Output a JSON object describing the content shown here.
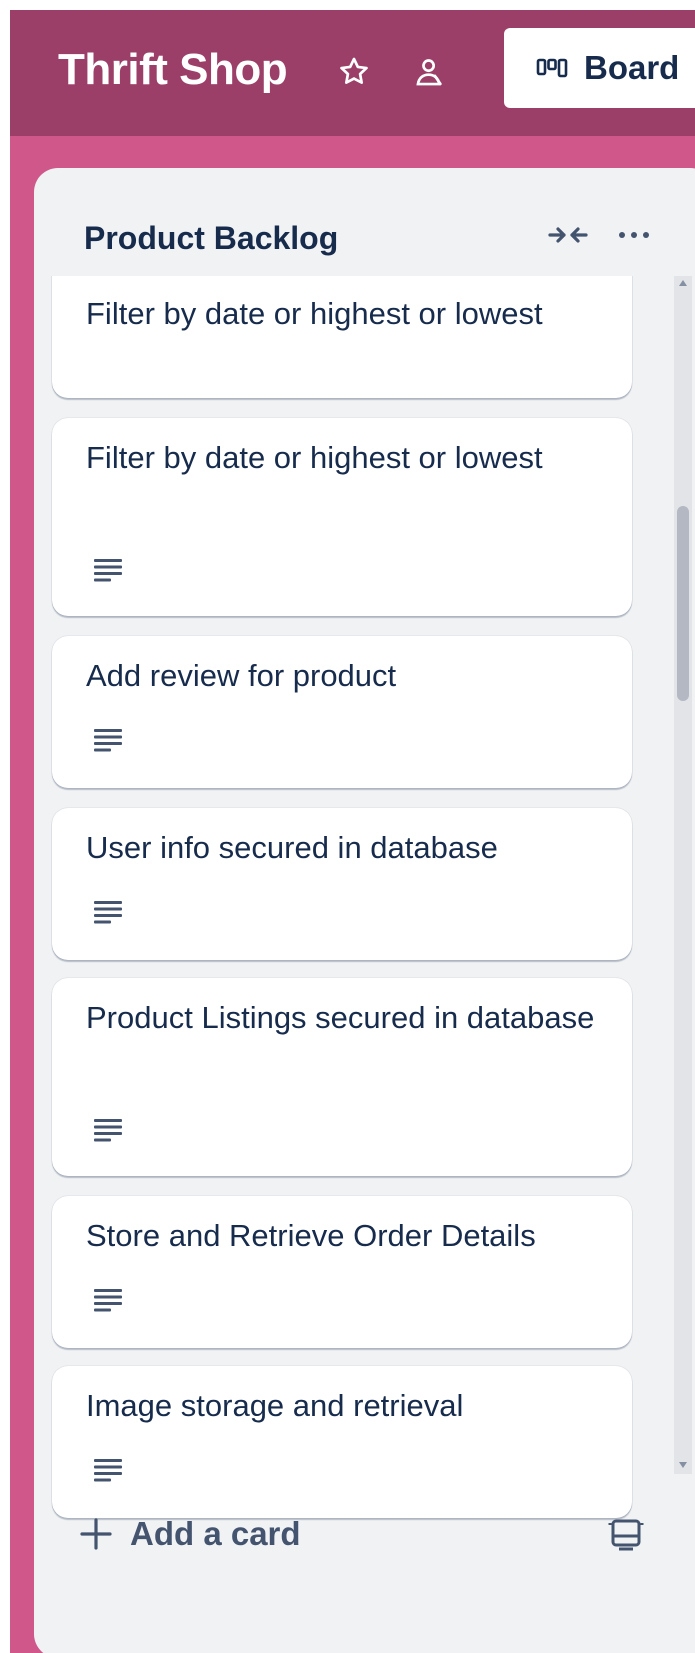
{
  "board": {
    "title": "Thrift Shop",
    "view_label": "Board",
    "colors": {
      "background": "#cf578a",
      "header": "#9c3f68",
      "list": "#f1f2f4"
    }
  },
  "topbar_icons": [
    "star-icon",
    "members-icon",
    "board-view-icon"
  ],
  "list": {
    "title": "Product Backlog",
    "cards": [
      {
        "title": "Filter by date or highest or lowest",
        "has_description": false
      },
      {
        "title": "Filter by date or highest or lowest",
        "has_description": true
      },
      {
        "title": "Add review for product",
        "has_description": true
      },
      {
        "title": "User info secured in database",
        "has_description": true
      },
      {
        "title": "Product Listings secured in database",
        "has_description": true
      },
      {
        "title": "Store and Retrieve Order Details",
        "has_description": true
      },
      {
        "title": "Image storage and retrieval",
        "has_description": true
      }
    ],
    "add_card_label": "Add a card"
  }
}
